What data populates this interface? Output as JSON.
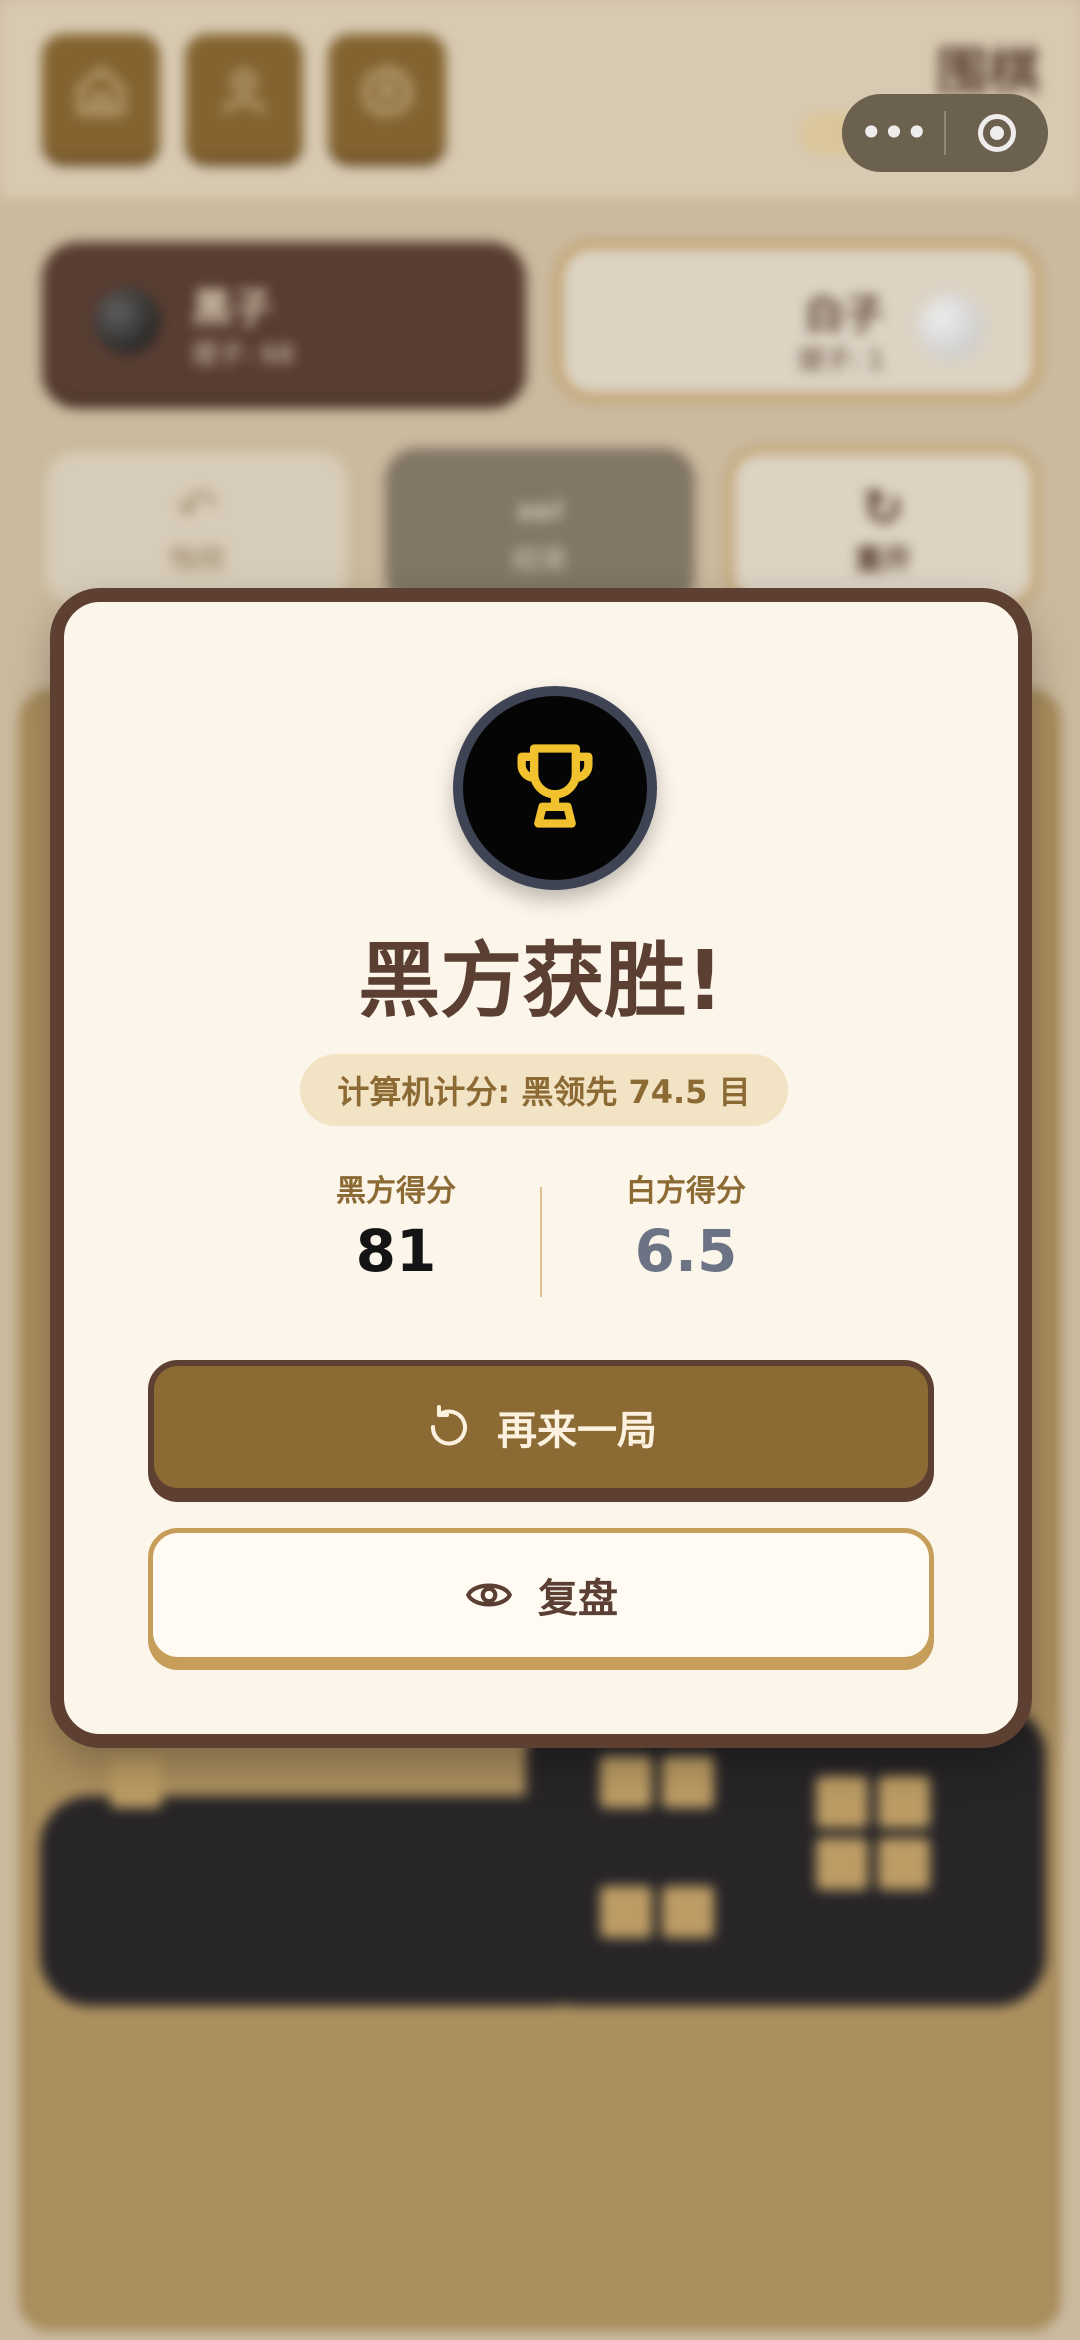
{
  "app": {
    "title": "围棋",
    "badge": "··"
  },
  "toolbar": {
    "home_icon": "home-icon",
    "profile_icon": "user-icon",
    "settings_icon": "gear-icon"
  },
  "capsule": {
    "more_icon": "more-dots-icon",
    "close_icon": "target-icon",
    "more_label": "•••"
  },
  "players": {
    "black": {
      "name": "黑子",
      "captures": "提子: 68"
    },
    "white": {
      "name": "白子",
      "captures": "提子: 1"
    }
  },
  "controls": {
    "undo": "悔棋",
    "pass": "结束",
    "reset": "重开"
  },
  "result": {
    "title": "黑方获胜!",
    "computer_score": "计算机计分: 黑领先 74.5 目",
    "black_label": "黑方得分",
    "black_score": "81",
    "white_label": "白方得分",
    "white_score": "6.5",
    "play_again": "再来一局",
    "review": "复盘"
  },
  "colors": {
    "brown_dark": "#5e4033",
    "brown_gold": "#8c6a34",
    "cream": "#fcf5ea",
    "trophy_gold": "#f2c12e"
  }
}
